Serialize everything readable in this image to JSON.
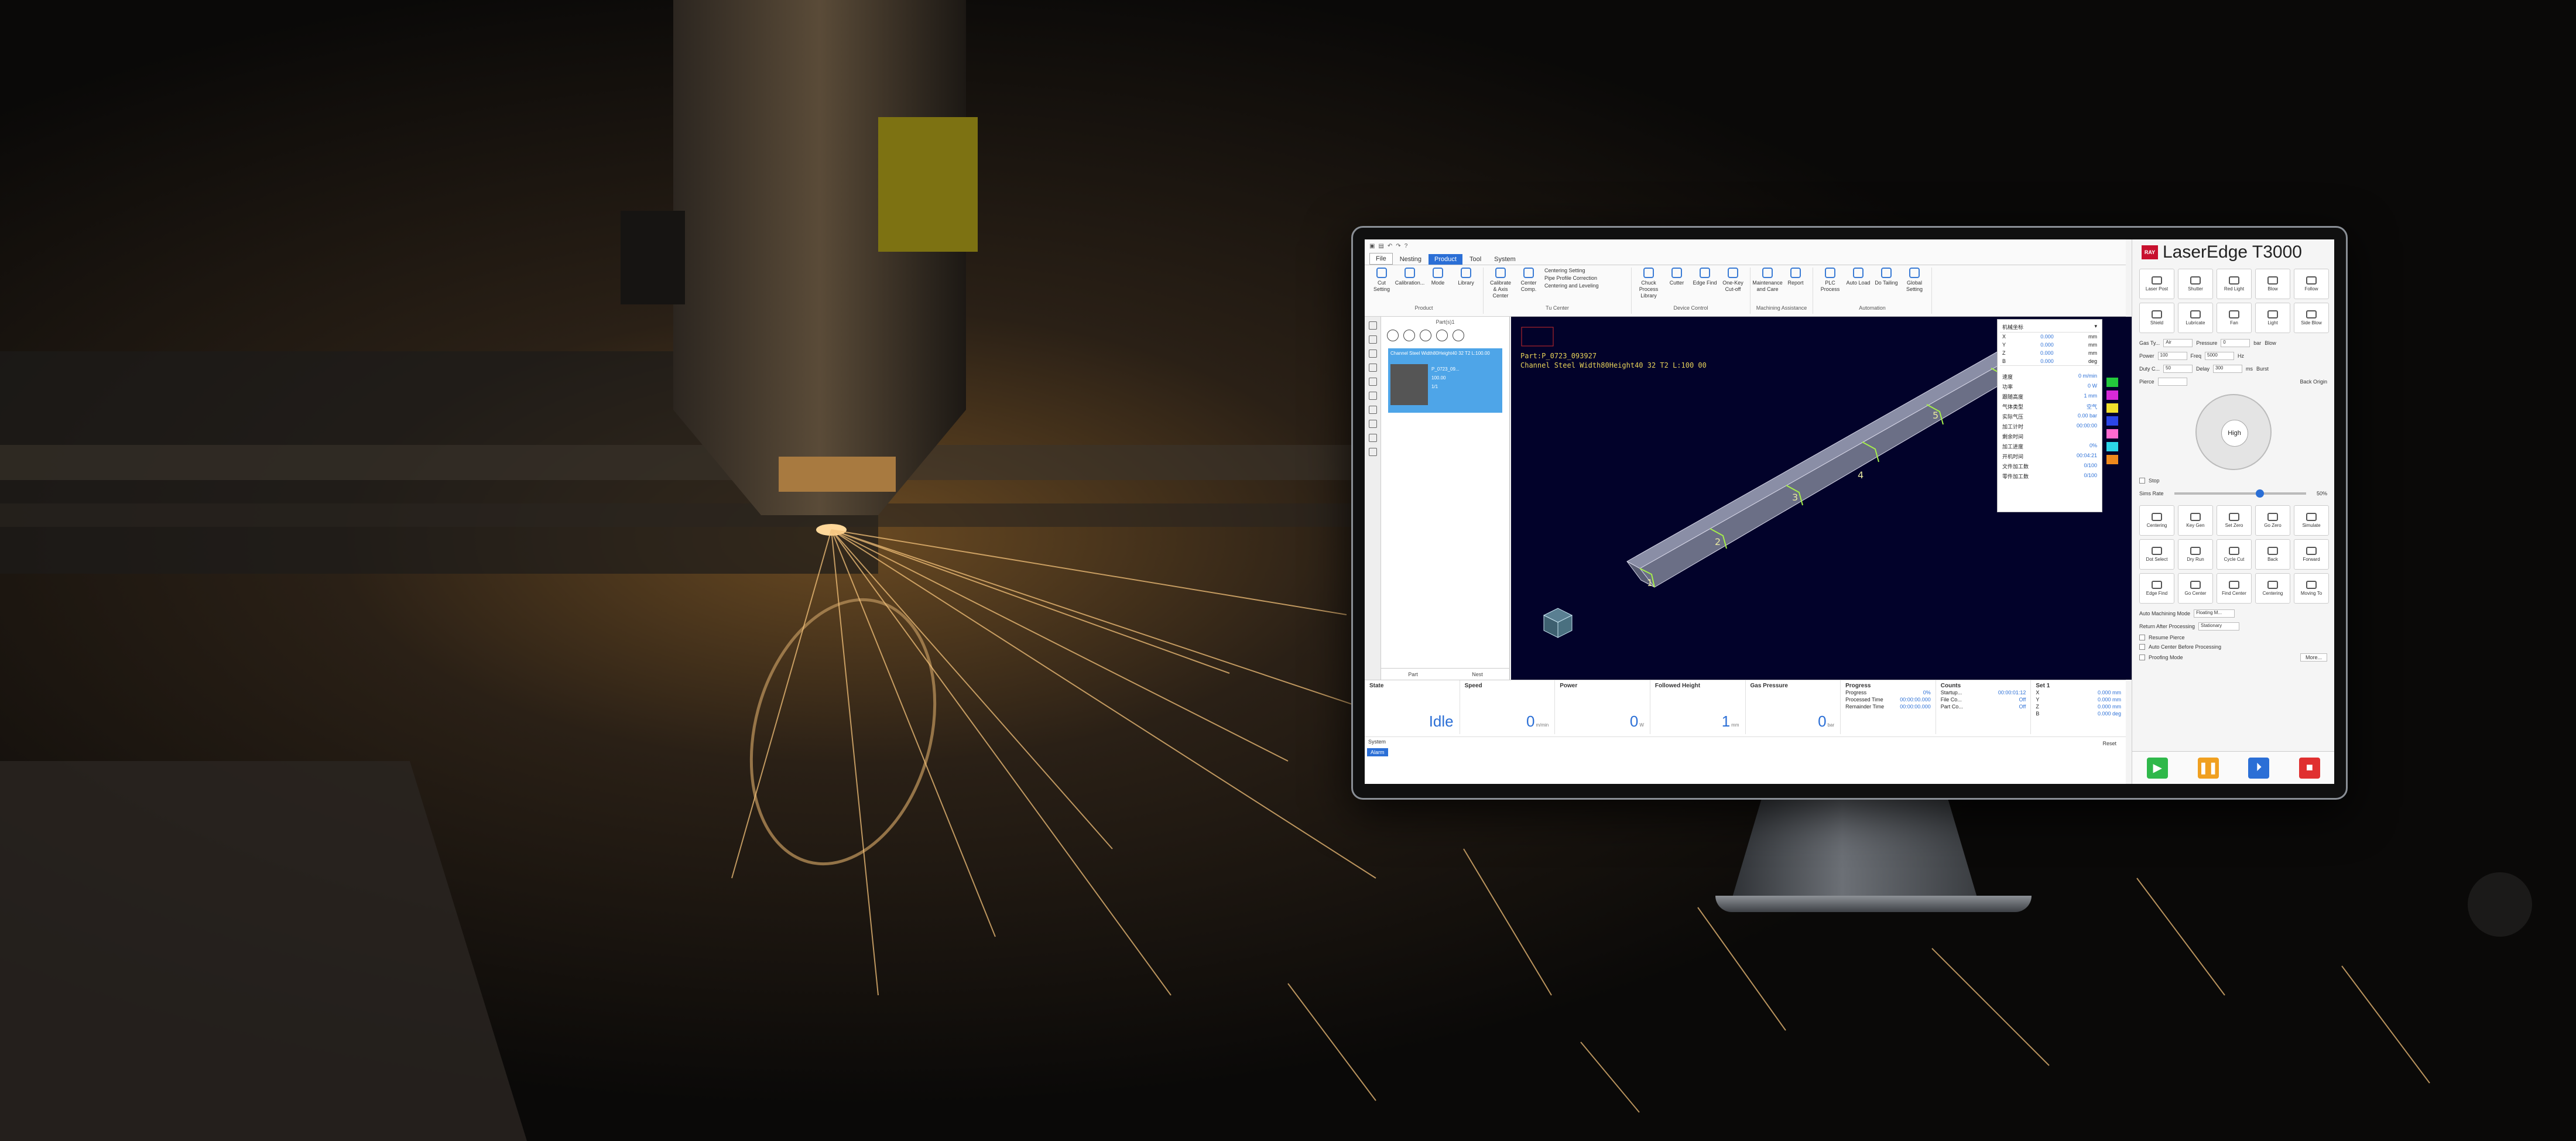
{
  "app": {
    "brand": "LaserEdge",
    "model": "T3000",
    "logo_text": "RAY"
  },
  "menus": [
    {
      "label": "File"
    },
    {
      "label": "Nesting"
    },
    {
      "label": "Product"
    },
    {
      "label": "Tool"
    },
    {
      "label": "System"
    }
  ],
  "ribbon": {
    "product": {
      "label": "Product",
      "buttons": [
        "Cut Setting",
        "Calibration...",
        "Mode",
        "Library"
      ]
    },
    "tucenter": {
      "label": "Tu Center",
      "buttons": [
        "Calibrate & Axis Center",
        "Center Comp."
      ],
      "list": [
        "Centering Setting",
        "Pipe Profile Correction",
        "Centering and Leveling"
      ]
    },
    "device": {
      "label": "Device Control",
      "buttons": [
        "Chuck Process Library",
        "Cutter",
        "Edge Find",
        "One-Key Cut-off"
      ]
    },
    "machining": {
      "label": "Machining Assistance",
      "buttons": [
        "Maintenance and Care",
        "Report"
      ]
    },
    "automation": {
      "label": "Automation",
      "buttons": [
        "PLC Process",
        "Auto Load",
        "Do Tailing",
        "Global Setting"
      ]
    }
  },
  "parts": {
    "title": "Part(s)1",
    "card_name": "Channel Steel Width80Height40 32 T2 L:100.00",
    "card_id": "P_0723_09...",
    "card_value": "100.00",
    "card_count": "1/1",
    "footer": [
      "Part",
      "Nest"
    ]
  },
  "canvas": {
    "line1": "Part:P_0723_093927",
    "line2": "Channel Steel Width80Height40 32 T2 L:100 00",
    "labels": [
      "1",
      "2",
      "3",
      "4",
      "5",
      "6"
    ]
  },
  "coords": {
    "header": "机械坐标",
    "axes": [
      {
        "axis": "X",
        "value": "0.000",
        "unit": "mm"
      },
      {
        "axis": "Y",
        "value": "0.000",
        "unit": "mm"
      },
      {
        "axis": "Z",
        "value": "0.000",
        "unit": "mm"
      },
      {
        "axis": "B",
        "value": "0.000",
        "unit": "deg"
      }
    ],
    "params": [
      {
        "k": "速度",
        "v": "0 m/min"
      },
      {
        "k": "功率",
        "v": "0 W"
      },
      {
        "k": "跟随高度",
        "v": "1 mm"
      },
      {
        "k": "气体类型",
        "v": "空气"
      },
      {
        "k": "实际气压",
        "v": "0.00 bar"
      },
      {
        "k": "加工计时",
        "v": "00:00:00"
      },
      {
        "k": "剩余时间",
        "v": ""
      },
      {
        "k": "加工进度",
        "v": "0%"
      },
      {
        "k": "开机时间",
        "v": "00:04:21"
      },
      {
        "k": "文件加工数",
        "v": "0/100"
      },
      {
        "k": "零件加工数",
        "v": "0/100"
      }
    ]
  },
  "layer_colors": [
    "#24c93c",
    "#d829d8",
    "#f1e02c",
    "#2b46e8",
    "#ff6ad0",
    "#2cd4e8",
    "#f08a1c"
  ],
  "status": {
    "state": {
      "label": "State",
      "value": "Idle"
    },
    "speed": {
      "label": "Speed",
      "value": "0",
      "unit": "m/min"
    },
    "power": {
      "label": "Power",
      "value": "0",
      "unit": "W"
    },
    "height": {
      "label": "Followed Height",
      "value": "1",
      "unit": "mm"
    },
    "gas": {
      "label": "Gas Pressure",
      "value": "0",
      "unit": "bar"
    },
    "progress": {
      "label": "Progress",
      "rows": [
        {
          "k": "Progress",
          "v": "0%"
        },
        {
          "k": "Processed Time",
          "v": "00:00:00.000"
        },
        {
          "k": "Remainder Time",
          "v": "00:00:00.000"
        }
      ]
    },
    "counts": {
      "label": "Counts",
      "rows": [
        {
          "k": "Startup...",
          "v": "00:00:01:12"
        },
        {
          "k": "File Co...",
          "v": "Off"
        },
        {
          "k": "Part Co...",
          "v": "Off"
        }
      ]
    },
    "coord_set": {
      "label": "Set 1",
      "rows": [
        {
          "k": "X",
          "v": "0.000 mm"
        },
        {
          "k": "Y",
          "v": "0.000 mm"
        },
        {
          "k": "Z",
          "v": "0.000 mm"
        },
        {
          "k": "B",
          "v": "0.000 deg"
        }
      ]
    }
  },
  "system": {
    "tab": "System",
    "alarm": "Alarm",
    "reset": "Reset"
  },
  "control": {
    "buttons": [
      "Laser Post",
      "Shutter",
      "Red Light",
      "Blow",
      "Follow",
      "Shield",
      "Lubricate",
      "Fan",
      "Light",
      "Side Blow"
    ],
    "fields": [
      {
        "k": "Gas Ty...",
        "v": "Air",
        "k2": "Pressure",
        "v2": "0",
        "u": "bar",
        "btn": "Blow"
      },
      {
        "k": "Power",
        "v": "100",
        "k2": "Freq",
        "v2": "5000",
        "u": "Hz",
        "btn": ""
      },
      {
        "k": "Duty C...",
        "v": "50",
        "k2": "Delay",
        "v2": "300",
        "u": "ms",
        "btn": "Burst"
      },
      {
        "k": "Pierce",
        "v": "",
        "k2": "",
        "v2": "",
        "u": "",
        "btn": "Back Origin"
      }
    ],
    "jog_center": "High",
    "stop_label": "Stop",
    "rate_label": "Sims Rate",
    "rate_value": "50%",
    "func_buttons": [
      "Centering",
      "Key Gen",
      "Set Zero",
      "Go Zero",
      "Simulate",
      "Dot Select",
      "Dry Run",
      "Cycle Cut",
      "Back",
      "Forward",
      "Edge Find",
      "Go Center",
      "Find Center",
      "Centering",
      "Moving To"
    ],
    "options": [
      {
        "k": "Auto Machining Mode",
        "v": "Floating M..."
      },
      {
        "k": "Return After Processing",
        "v": "Stationary"
      }
    ],
    "checks": [
      "Resume Pierce",
      "Auto Center Before Processing",
      "Proofing Mode"
    ],
    "more": "More..."
  }
}
